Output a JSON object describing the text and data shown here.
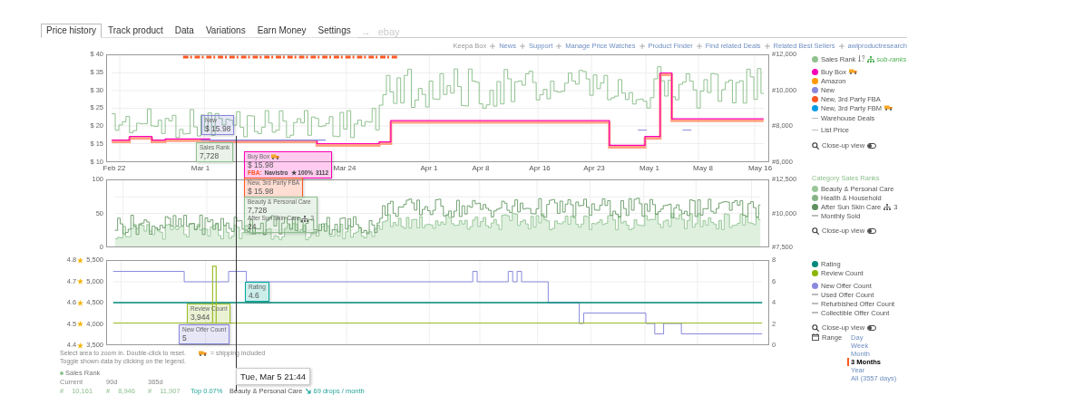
{
  "tabs": [
    {
      "label": "Price history",
      "selected": true
    },
    {
      "label": "Track product",
      "selected": false
    },
    {
      "label": "Data",
      "selected": false
    },
    {
      "label": "Variations",
      "selected": false
    },
    {
      "label": "Earn Money",
      "selected": false
    },
    {
      "label": "Settings",
      "selected": false
    }
  ],
  "tab_arrow": "→",
  "ebay_label": "ebay",
  "links": [
    {
      "label": "Keepa Box",
      "muted": true
    },
    {
      "label": "News",
      "muted": false
    },
    {
      "label": "Support",
      "muted": false
    },
    {
      "label": "Manage Price Watches",
      "muted": false
    },
    {
      "label": "Product Finder",
      "muted": false
    },
    {
      "label": "Find related Deals",
      "muted": false
    },
    {
      "label": "Related Best Sellers",
      "muted": false
    },
    {
      "label": "awlproductresearch",
      "muted": false
    }
  ],
  "charts": [
    {
      "kind": "price",
      "left_ticks": [
        "$ 40",
        "$ 35",
        "$ 30",
        "$ 25",
        "$ 20",
        "$ 15",
        "$ 10"
      ],
      "right_ticks": [
        "#12,000",
        "#10,000",
        "#8,000",
        "#6,000"
      ],
      "x_ticks": [
        "Feb 22",
        "Mar 1",
        "Mar 24",
        "Apr 1",
        "Apr 8",
        "Apr 16",
        "Apr 23",
        "May 1",
        "May 8",
        "May 16"
      ]
    },
    {
      "kind": "rank",
      "left_ticks": [
        "100",
        "50",
        "0"
      ],
      "right_ticks": [
        "#12,500",
        "#10,000",
        "#7,500"
      ]
    },
    {
      "kind": "offers",
      "left_ticks": [
        {
          "rating": "4.8",
          "count": "5,500"
        },
        {
          "rating": "4.7",
          "count": "5,000"
        },
        {
          "rating": "4.6",
          "count": "4,500"
        },
        {
          "rating": "4.5",
          "count": "4,000"
        },
        {
          "rating": "4.4",
          "count": "3,500"
        }
      ],
      "right_ticks": [
        "8",
        "6",
        "4",
        "2",
        "0"
      ]
    }
  ],
  "legends": [
    {
      "groups": [
        [
          {
            "label": "Sales Rank",
            "kind": "dot",
            "color": "#8fc18f",
            "sub_ranks": "sub-ranks"
          },
          {
            "label": "Buy Box",
            "kind": "dot",
            "color": "#ff00b4",
            "shipping": true
          },
          {
            "label": "Amazon",
            "kind": "dot",
            "color": "#ff9900"
          },
          {
            "label": "New",
            "kind": "dot",
            "color": "#8888dd"
          },
          {
            "label": "New, 3rd Party FBA",
            "kind": "dot",
            "color": "#ff5722"
          },
          {
            "label": "New, 3rd Party FBM",
            "kind": "dot",
            "color": "#039be5",
            "shipping": true
          },
          {
            "label": "Warehouse Deals",
            "kind": "dash"
          },
          {
            "label": "List Price",
            "kind": "dash"
          }
        ]
      ],
      "closeup": "Close-up view"
    },
    {
      "heading": "Category Sales Ranks",
      "groups": [
        [
          {
            "label": "Beauty & Personal Care",
            "kind": "dot",
            "color": "#99c799"
          },
          {
            "label": "Health & Household",
            "kind": "dot",
            "color": "#85b385"
          },
          {
            "label": "After Sun Skin Care",
            "kind": "dot",
            "color": "#5f8f5f",
            "sub_count": "3"
          },
          {
            "label": "Monthly Sold",
            "kind": "dash"
          }
        ]
      ],
      "closeup": "Close-up view"
    },
    {
      "groups": [
        [
          {
            "label": "Rating",
            "kind": "dot",
            "color": "#00897b"
          },
          {
            "label": "Review Count",
            "kind": "dot",
            "color": "#8cb400"
          }
        ],
        [
          {
            "label": "New Offer Count",
            "kind": "dot",
            "color": "#8888dd"
          },
          {
            "label": "Used Offer Count",
            "kind": "dash"
          },
          {
            "label": "Refurbished Offer Count",
            "kind": "dash"
          },
          {
            "label": "Collectible Offer Count",
            "kind": "dash"
          }
        ]
      ],
      "closeup": "Close-up view",
      "range": {
        "label": "Range",
        "options": [
          {
            "label": "Day",
            "selected": false
          },
          {
            "label": "Week",
            "selected": false
          },
          {
            "label": "Month",
            "selected": false
          },
          {
            "label": "3 Months",
            "selected": true
          },
          {
            "label": "Year",
            "selected": false
          },
          {
            "label": "All (3557 days)",
            "selected": false
          }
        ]
      }
    }
  ],
  "tooltips": [
    {
      "title": "New",
      "value": "$ 15.98",
      "color": "#8888dd"
    },
    {
      "title": "Sales Rank",
      "value": "7,728",
      "color": "#8fc18f"
    },
    {
      "title": "Buy Box",
      "value": "$ 15.98",
      "color": "#ff00b4",
      "shipping": true,
      "detail": {
        "tag": "FBA:",
        "seller": "Navistro",
        "rating": "★ 100%",
        "count": "3112"
      }
    },
    {
      "title": "New, 3rd Party FBA",
      "value": "$ 15.98",
      "color": "#ff5722"
    },
    {
      "title": "Beauty & Personal Care",
      "value": "7,728",
      "color": "#8fc18f",
      "sub_title": "After Sun Skin Care",
      "sub_count": "3",
      "sub_value": "24"
    },
    {
      "title": "Rating",
      "value": "4.6",
      "color": "#00a99d"
    },
    {
      "title": "Review Count",
      "value": "3,944",
      "color": "#9cbf2a"
    },
    {
      "title": "New Offer Count",
      "value": "5",
      "color": "#8888dd"
    }
  ],
  "crosshair_time": "Tue, Mar 5 21:44",
  "notes": [
    "Select area to zoom in. Double-click to reset.",
    "Toggle shown data by clicking on the legend."
  ],
  "shipping_note": "= shipping included",
  "stats": {
    "title": "Sales Rank",
    "columns": [
      "Current",
      "90d",
      "365d"
    ],
    "values": [
      {
        "mark": "#",
        "value": "10,161"
      },
      {
        "mark": "#",
        "value": "8,946"
      },
      {
        "mark": "#",
        "value": "11,907"
      }
    ],
    "top": "Top 0.07%",
    "category": "Beauty & Personal Care",
    "drops": "69 drops / month"
  }
}
